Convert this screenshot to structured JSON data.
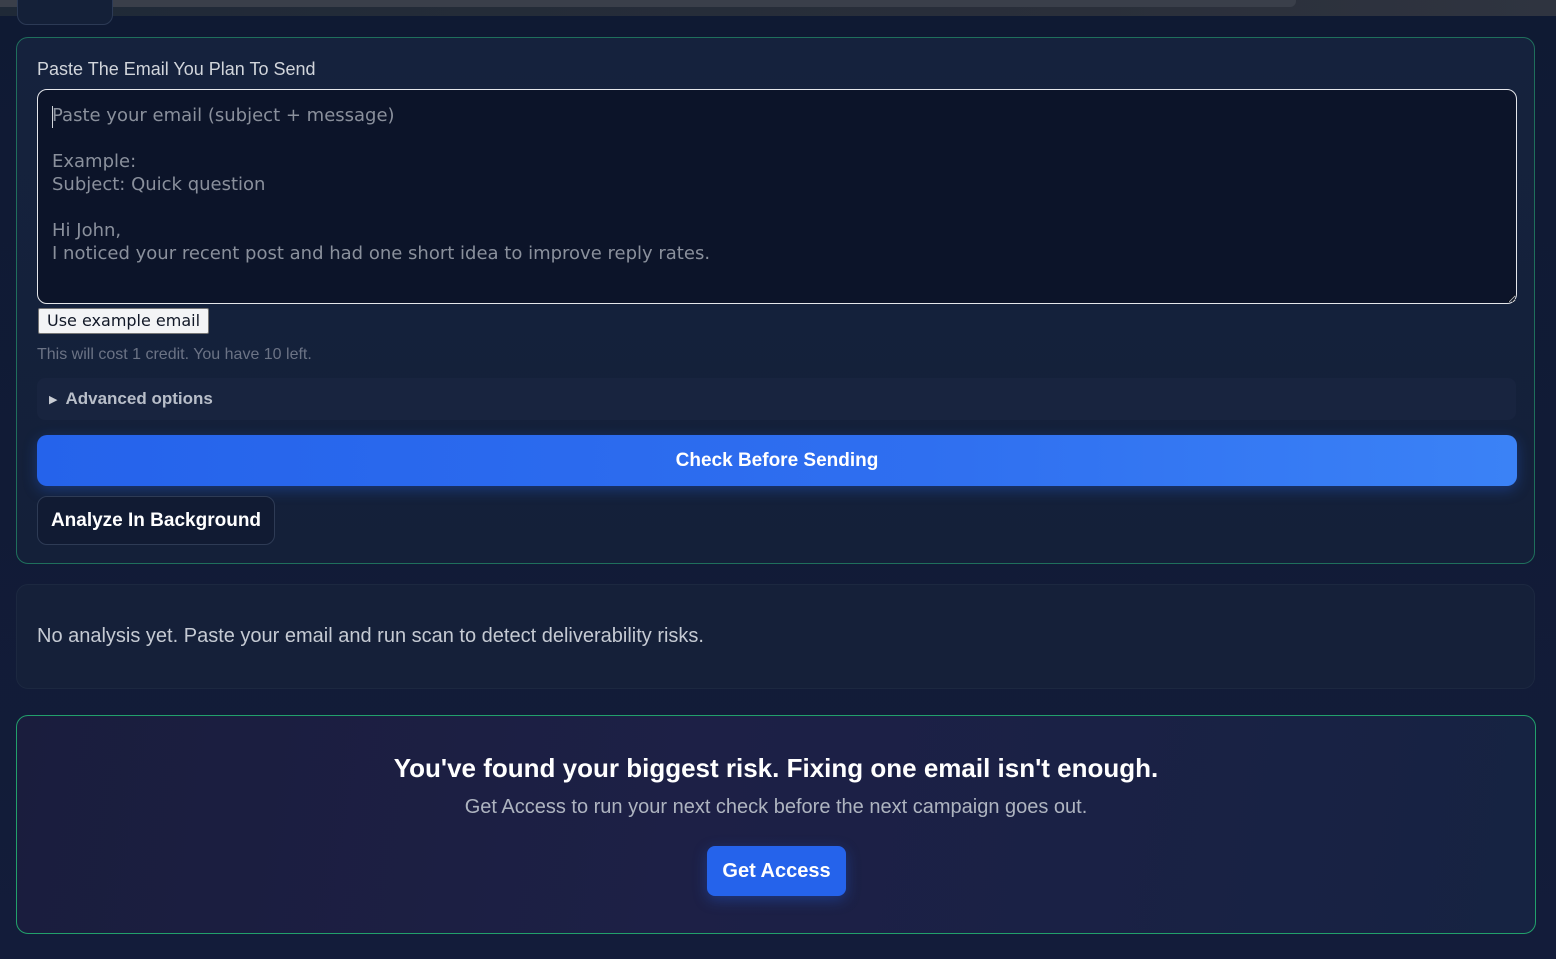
{
  "form": {
    "label": "Paste The Email You Plan To Send",
    "textarea_placeholder": "Paste your email (subject + message)\n\nExample:\nSubject: Quick question\n\nHi John,\nI noticed your recent post and had one short idea to improve reply rates.",
    "textarea_value": "",
    "example_button_label": "Use example email",
    "credit_note": "This will cost 1 credit. You have 10 left.",
    "advanced_label": "Advanced options",
    "check_button_label": "Check Before Sending",
    "background_button_label": "Analyze In Background"
  },
  "result": {
    "empty_text": "No analysis yet. Paste your email and run scan to detect deliverability risks."
  },
  "cta": {
    "title": "You've found your biggest risk. Fixing one email isn't enough.",
    "subtitle": "Get Access to run your next check before the next campaign goes out.",
    "button_label": "Get Access"
  },
  "colors": {
    "accent": "#2563eb",
    "card_border": "#1f6f5c",
    "cta_border": "#22a06b",
    "background": "#111b36"
  }
}
